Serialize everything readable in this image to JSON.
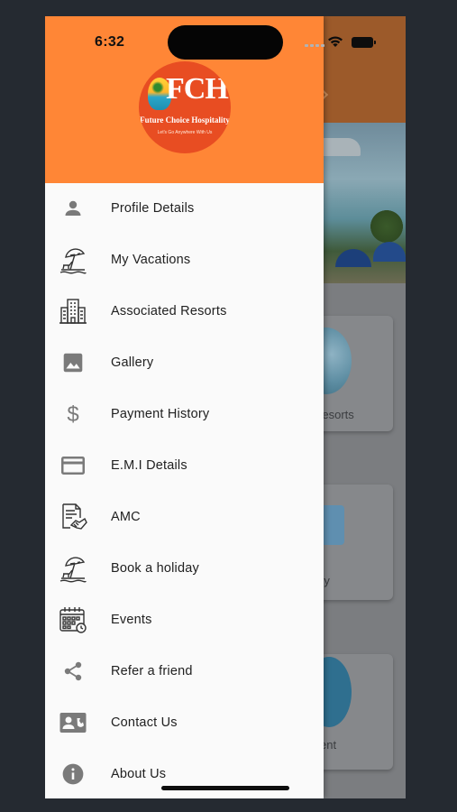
{
  "status_bar": {
    "time": "6:32"
  },
  "drawer": {
    "logo": {
      "letters": "FCH",
      "name": "Future Choice Hospitality",
      "tagline": "Let's Go Anywhere With Us"
    },
    "menu": [
      {
        "label": "Profile Details",
        "icon": "person-icon"
      },
      {
        "label": "My Vacations",
        "icon": "beach-umbrella-icon"
      },
      {
        "label": "Associated Resorts",
        "icon": "hotel-building-icon"
      },
      {
        "label": "Gallery",
        "icon": "image-icon"
      },
      {
        "label": "Payment History",
        "icon": "dollar-icon"
      },
      {
        "label": "E.M.I Details",
        "icon": "credit-card-icon"
      },
      {
        "label": "AMC",
        "icon": "contract-handshake-icon"
      },
      {
        "label": "Book a holiday",
        "icon": "beach-umbrella-icon"
      },
      {
        "label": "Events",
        "icon": "calendar-icon"
      },
      {
        "label": "Refer a friend",
        "icon": "share-icon"
      },
      {
        "label": "Contact Us",
        "icon": "contact-card-icon"
      },
      {
        "label": "About Us",
        "icon": "info-icon"
      }
    ]
  },
  "background": {
    "card_labels": [
      "Resorts",
      "ry",
      "ent"
    ]
  },
  "colors": {
    "drawer_header": "#ff8636",
    "logo_circle": "#e84d22",
    "menu_icon": "#7a7a7a",
    "menu_text": "#212121"
  }
}
